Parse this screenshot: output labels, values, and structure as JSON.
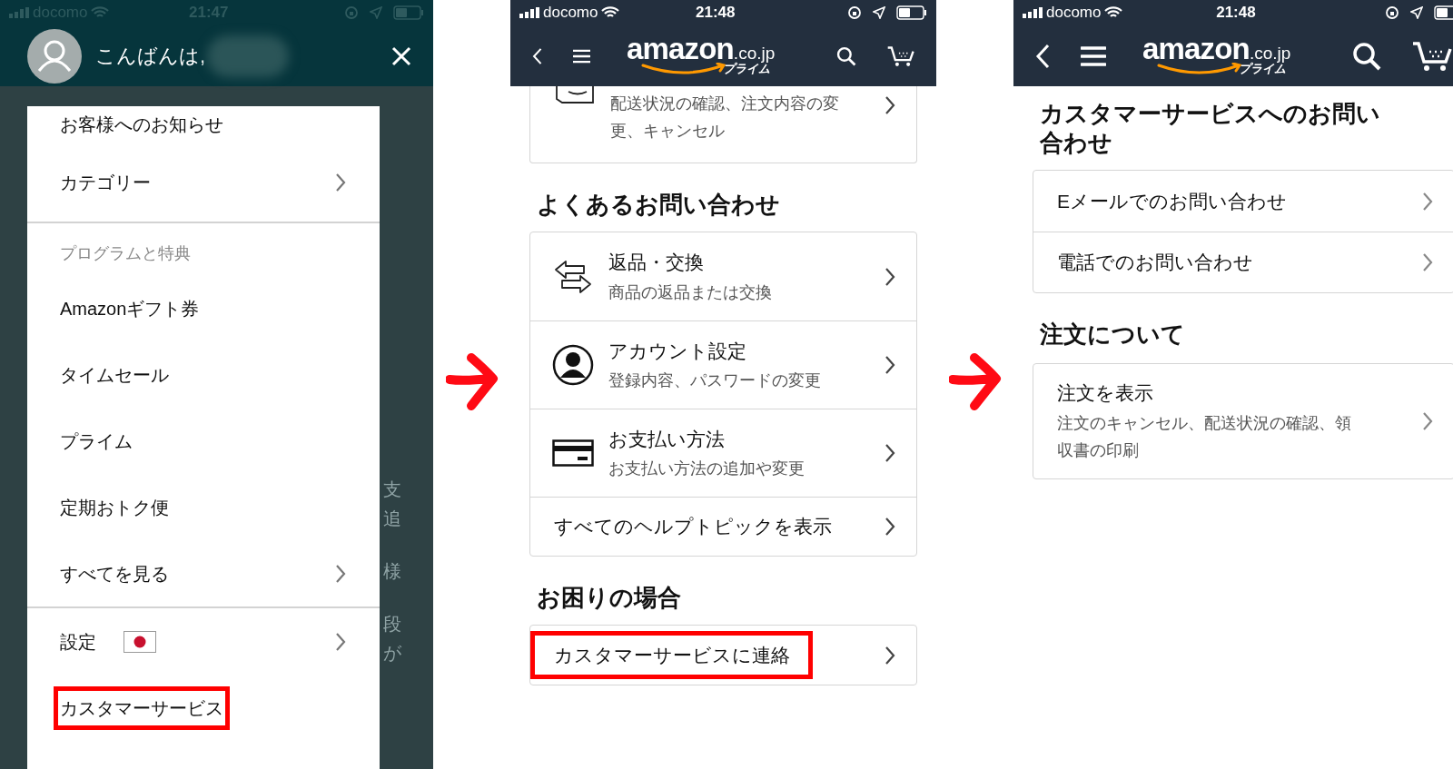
{
  "screen_1": {
    "status_bar": {
      "carrier": "docomo",
      "time": "21:47"
    },
    "greeting": "こんばんは,",
    "background_text": [
      "支",
      "追",
      "様",
      "段",
      "が"
    ],
    "sections": [
      {
        "items": [
          {
            "label": "お客様へのお知らせ",
            "chevron": false,
            "flag": false,
            "highlighted": false
          },
          {
            "label": "カテゴリー",
            "chevron": true,
            "flag": false,
            "highlighted": false
          }
        ]
      },
      {
        "header": "プログラムと特典",
        "items": [
          {
            "label": "Amazonギフト券",
            "chevron": false,
            "flag": false,
            "highlighted": false
          },
          {
            "label": "タイムセール",
            "chevron": false,
            "flag": false,
            "highlighted": false
          },
          {
            "label": "プライム",
            "chevron": false,
            "flag": false,
            "highlighted": false
          },
          {
            "label": "定期おトク便",
            "chevron": false,
            "flag": false,
            "highlighted": false
          },
          {
            "label": "すべてを見る",
            "chevron": true,
            "flag": false,
            "highlighted": false
          }
        ]
      },
      {
        "items": [
          {
            "label": "設定",
            "chevron": true,
            "flag": true,
            "highlighted": false
          },
          {
            "label": "カスタマーサービス",
            "chevron": false,
            "flag": false,
            "highlighted": true
          }
        ]
      }
    ]
  },
  "screen_2": {
    "status_bar": {
      "carrier": "docomo",
      "time": "21:48"
    },
    "logo": {
      "word": "amazon",
      "suffix": ".co.jp",
      "sub": "プライム"
    },
    "partial_card": {
      "description": "配送状況の確認、注文内容の変更、キャンセル"
    },
    "sections": [
      {
        "title": "よくあるお問い合わせ",
        "rows": [
          {
            "kind": "exchange",
            "title": "返品・交換",
            "subtitle": "商品の返品または交換",
            "highlighted": false
          },
          {
            "kind": "account",
            "title": "アカウント設定",
            "subtitle": "登録内容、パスワードの変更",
            "highlighted": false
          },
          {
            "kind": "payment",
            "title": "お支払い方法",
            "subtitle": "お支払い方法の追加や変更",
            "highlighted": false
          },
          {
            "kind": "plain",
            "title": "すべてのヘルプトピックを表示",
            "highlighted": false
          }
        ]
      },
      {
        "title": "お困りの場合",
        "rows": [
          {
            "kind": "plain",
            "title": "カスタマーサービスに連絡",
            "highlighted": true
          }
        ]
      }
    ]
  },
  "screen_3": {
    "status_bar": {
      "carrier": "docomo",
      "time": "21:48"
    },
    "logo": {
      "word": "amazon",
      "suffix": ".co.jp",
      "sub": "プライム"
    },
    "title": "カスタマーサービスへのお問い合わせ",
    "sections": [
      {
        "rows": [
          {
            "title": "Eメールでのお問い合わせ"
          },
          {
            "title": "電話でのお問い合わせ"
          }
        ]
      },
      {
        "title": "注文について",
        "rows": [
          {
            "title": "注文を表示",
            "subtitle": "注文のキャンセル、配送状況の確認、領収書の印刷"
          }
        ]
      }
    ]
  }
}
